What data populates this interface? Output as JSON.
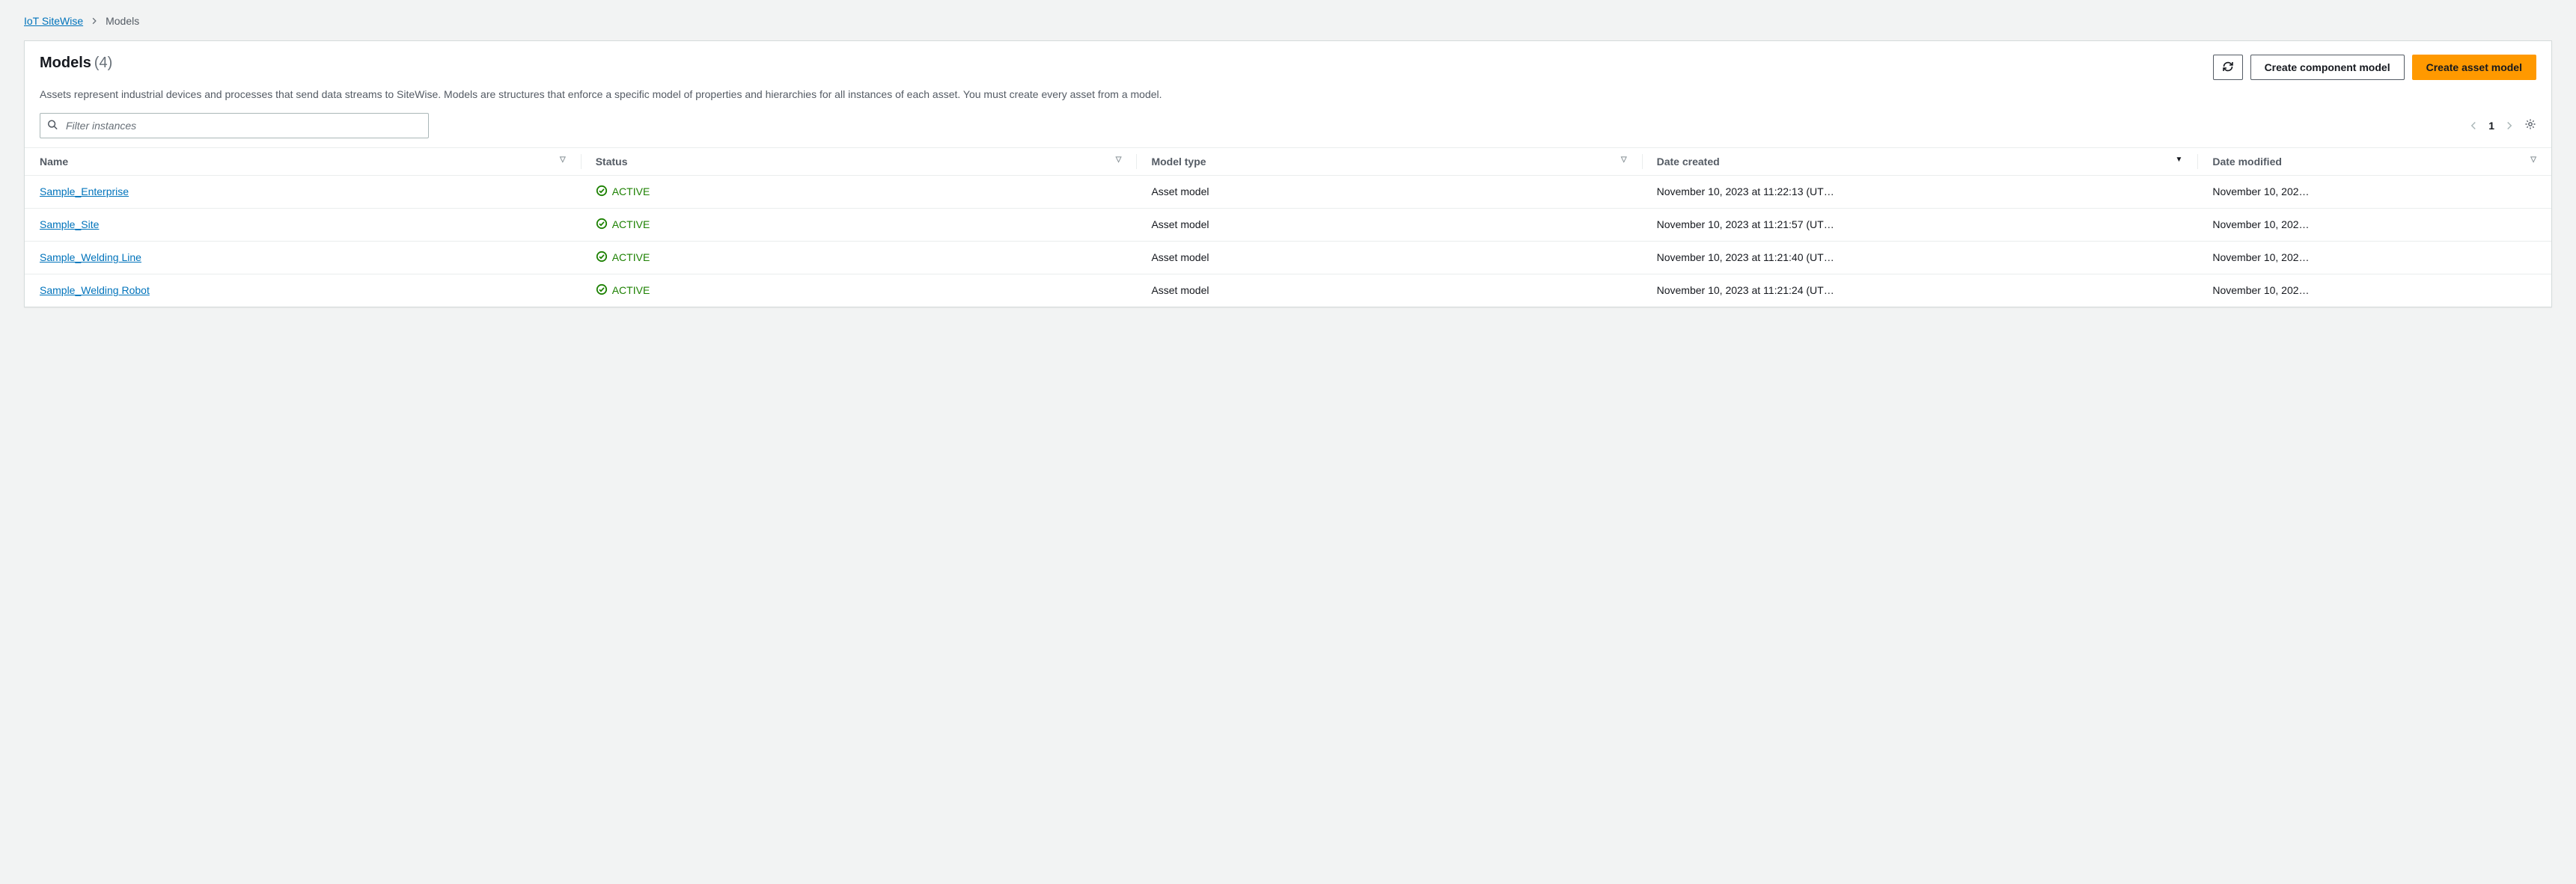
{
  "breadcrumb": {
    "root": "IoT SiteWise",
    "current": "Models"
  },
  "panel": {
    "title": "Models",
    "count": "(4)",
    "description": "Assets represent industrial devices and processes that send data streams to SiteWise. Models are structures that enforce a specific model of properties and hierarchies for all instances of each asset. You must create every asset from a model.",
    "actions": {
      "refresh_aria": "Refresh",
      "create_component": "Create component model",
      "create_asset": "Create asset model"
    }
  },
  "search": {
    "placeholder": "Filter instances"
  },
  "pager": {
    "page": "1"
  },
  "columns": {
    "name": "Name",
    "status": "Status",
    "type": "Model type",
    "created": "Date created",
    "modified": "Date modified"
  },
  "rows": [
    {
      "name": "Sample_Enterprise",
      "status": "ACTIVE",
      "type": "Asset model",
      "created": "November 10, 2023 at 11:22:13 (UT…",
      "modified": "November 10, 202…"
    },
    {
      "name": "Sample_Site",
      "status": "ACTIVE",
      "type": "Asset model",
      "created": "November 10, 2023 at 11:21:57 (UT…",
      "modified": "November 10, 202…"
    },
    {
      "name": "Sample_Welding Line",
      "status": "ACTIVE",
      "type": "Asset model",
      "created": "November 10, 2023 at 11:21:40 (UT…",
      "modified": "November 10, 202…"
    },
    {
      "name": "Sample_Welding Robot",
      "status": "ACTIVE",
      "type": "Asset model",
      "created": "November 10, 2023 at 11:21:24 (UT…",
      "modified": "November 10, 202…"
    }
  ]
}
